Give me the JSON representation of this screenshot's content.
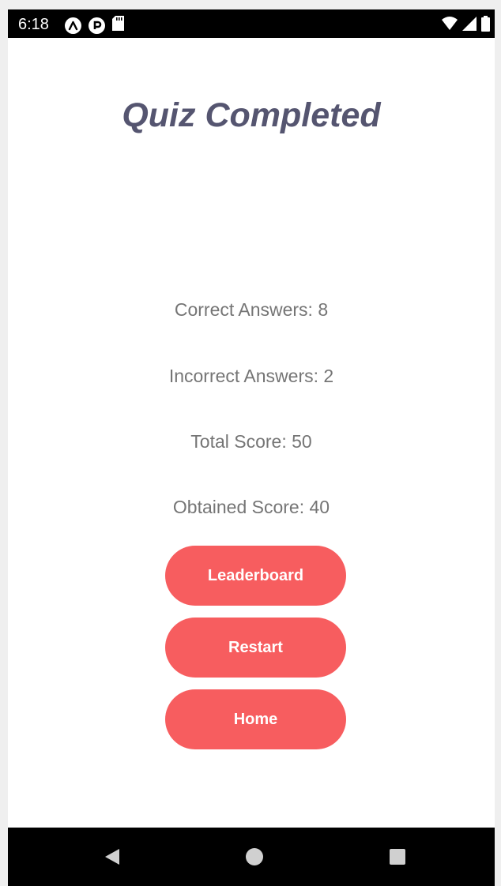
{
  "status_bar": {
    "time": "6:18",
    "left_icons": [
      "expo-icon",
      "p-icon",
      "sd-card-icon"
    ],
    "right_icons": [
      "wifi-icon",
      "cell-signal-icon",
      "battery-icon"
    ]
  },
  "screen": {
    "title": "Quiz Completed",
    "stats": {
      "correct": "Correct Answers: 8",
      "incorrect": "Incorrect Answers: 2",
      "total": "Total Score: 50",
      "obtained": "Obtained Score: 40"
    },
    "buttons": {
      "leaderboard": "Leaderboard",
      "restart": "Restart",
      "home": "Home"
    }
  },
  "nav_bar": {
    "icons": [
      "back-icon",
      "home-icon",
      "recent-apps-icon"
    ]
  },
  "colors": {
    "title": "#555570",
    "stat_text": "#757575",
    "button_bg": "#f75d5f",
    "button_text": "#ffffff",
    "bars": "#000000"
  }
}
